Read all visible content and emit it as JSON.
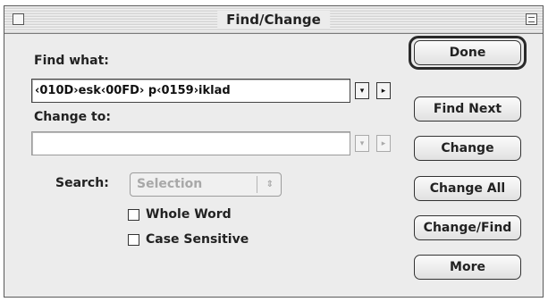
{
  "window": {
    "title": "Find/Change"
  },
  "find": {
    "label": "Find what:",
    "value": "‹010D›esk‹00FD› p‹0159›iklad"
  },
  "change": {
    "label": "Change to:",
    "value": ""
  },
  "search": {
    "label": "Search:",
    "selected": "Selection",
    "arrows": "⇕"
  },
  "options": {
    "whole_word": "Whole Word",
    "case_sensitive": "Case Sensitive"
  },
  "buttons": {
    "done": "Done",
    "find_next": "Find Next",
    "change": "Change",
    "change_all": "Change All",
    "change_find": "Change/Find",
    "more": "More"
  },
  "icons": {
    "dropdown": "▾",
    "insert": "▸"
  },
  "colors": {
    "window_bg": "#ececec",
    "disabled_text": "#a8a8a8"
  }
}
